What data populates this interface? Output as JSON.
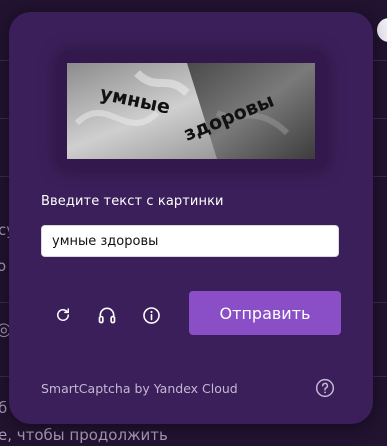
{
  "captcha": {
    "image_text_left": "умные",
    "image_text_right": "здоровы",
    "prompt": "Введите текст с картинки",
    "input_value": "умные здоровы",
    "submit_label": "Отправить",
    "refresh_icon": "refresh-icon",
    "audio_icon": "headphones-icon",
    "info_icon": "info-icon",
    "help_icon": "help-icon",
    "footer": "SmartCaptcha by Yandex Cloud"
  },
  "background": {
    "fragment_1": "су",
    "fragment_2": "о",
    "fragment_3": "б",
    "fragment_4": "е, чтобы продолжить"
  },
  "colors": {
    "modal": "#3b1f5a",
    "submit": "#8a4ec7",
    "page": "#221331"
  }
}
